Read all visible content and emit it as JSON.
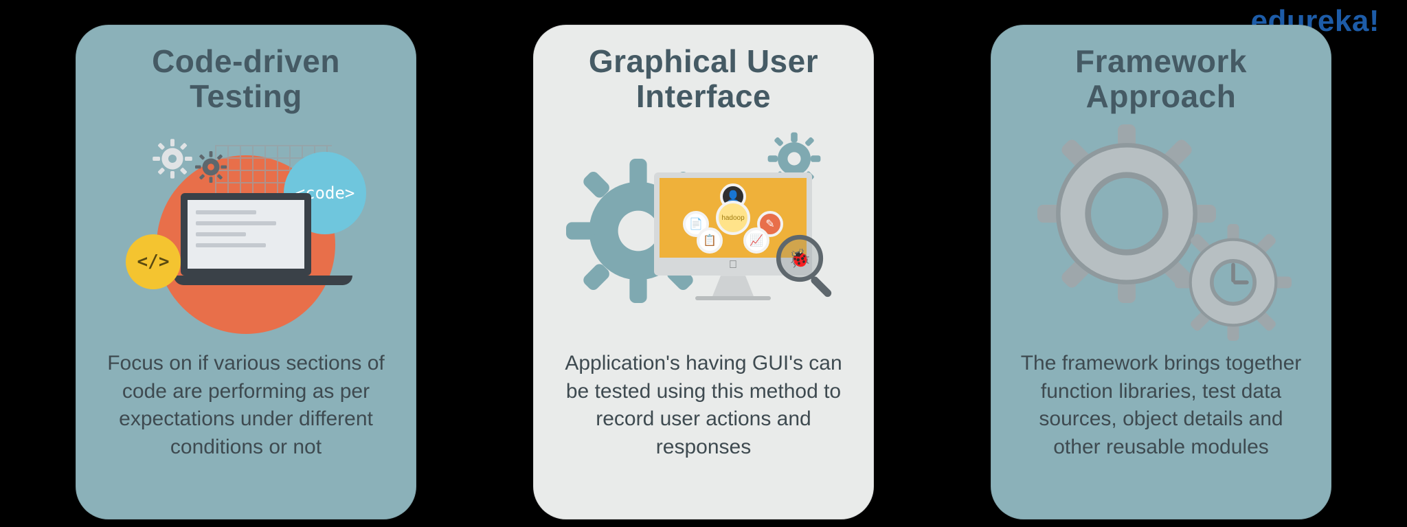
{
  "brand": "edureka!",
  "cards": [
    {
      "title": "Code-driven Testing",
      "desc": "Focus on if various sections of code are performing as per expectations under different conditions or not",
      "badge_code": "<code>",
      "badge_tag": "</>"
    },
    {
      "title": "Graphical User Interface",
      "desc": "Application's having GUI's can be tested using this method to record user actions and responses",
      "center_label": "hadoop"
    },
    {
      "title": "Framework Approach",
      "desc": "The framework brings together function libraries, test data sources, object details and other reusable modules"
    }
  ]
}
